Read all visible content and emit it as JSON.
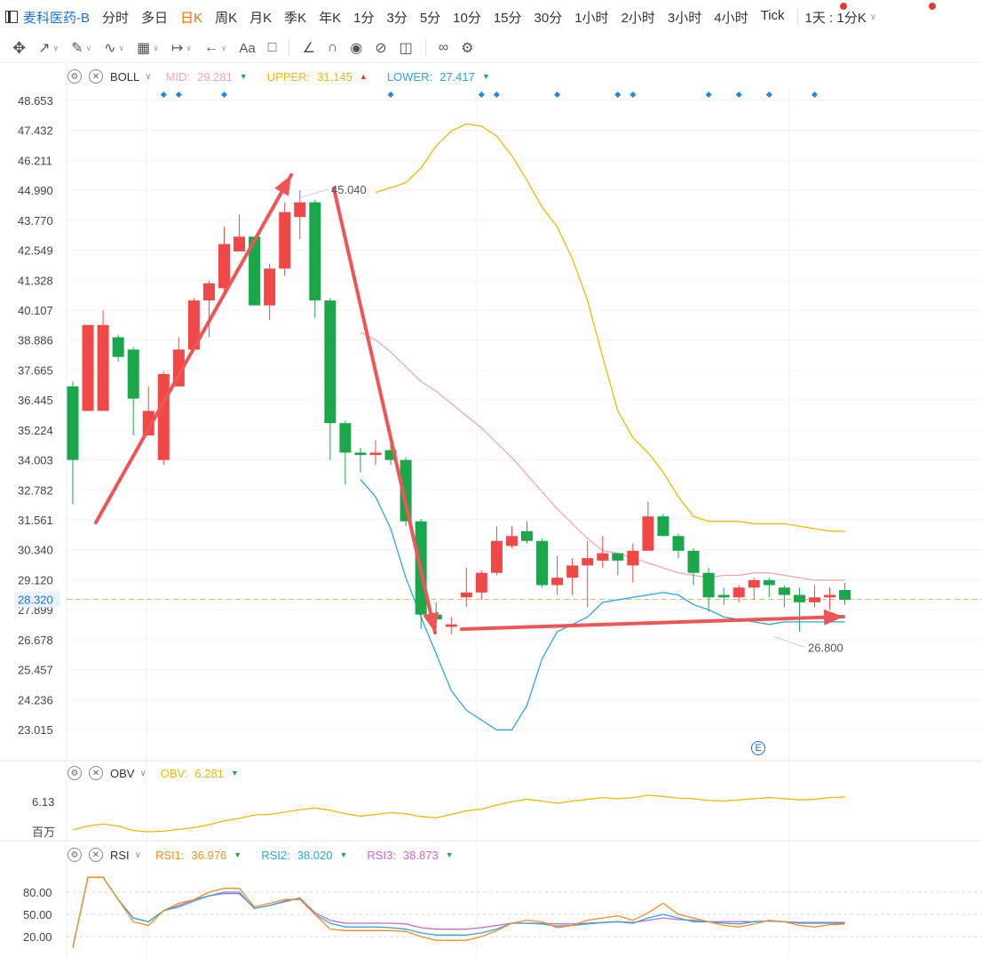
{
  "topbar": {
    "symbol": "麦科医药-B",
    "periods": [
      "分时",
      "多日",
      "日K",
      "周K",
      "月K",
      "季K",
      "年K",
      "1分",
      "3分",
      "5分",
      "10分",
      "15分",
      "30分",
      "1小时",
      "2小时",
      "3小时",
      "4小时",
      "Tick"
    ],
    "active_period": "日K",
    "interval_label": "1天 : 1分K"
  },
  "boll": {
    "name": "BOLL",
    "mid_label": "MID:",
    "mid_value": "29.281",
    "upper_label": "UPPER:",
    "upper_value": "31.145",
    "lower_label": "LOWER:",
    "lower_value": "27.417",
    "colors": {
      "mid": "#f7a6b5",
      "upper": "#f5b800",
      "lower": "#29a7e1"
    }
  },
  "price_axis": [
    "48.653",
    "47.432",
    "46.211",
    "44.990",
    "43.770",
    "42.549",
    "41.328",
    "40.107",
    "38.886",
    "37.665",
    "36.445",
    "35.224",
    "34.003",
    "32.782",
    "31.561",
    "30.340",
    "29.120",
    "27.899",
    "26.678",
    "25.457",
    "24.236",
    "23.015"
  ],
  "current_price": "28.320",
  "annotations": {
    "high": "45.040",
    "low": "26.800"
  },
  "obv": {
    "name": "OBV",
    "label": "OBV:",
    "value": "6.281",
    "axis_value": "6.13",
    "unit": "百万"
  },
  "rsi": {
    "name": "RSI",
    "rsi1_label": "RSI1:",
    "rsi1_value": "36.976",
    "rsi2_label": "RSI2:",
    "rsi2_value": "38.020",
    "rsi3_label": "RSI3:",
    "rsi3_value": "38.873",
    "axis": [
      "80.00",
      "50.00",
      "20.00"
    ],
    "colors": {
      "rsi1": "#ff8c1a",
      "rsi2": "#29a7e1",
      "rsi3": "#cc66cc"
    }
  },
  "chart_data": {
    "type": "candlestick",
    "candles": [
      [
        37.0,
        34.0,
        37.2,
        32.2
      ],
      [
        36.0,
        39.5,
        39.5,
        36.0
      ],
      [
        36.0,
        39.5,
        40.1,
        36.0
      ],
      [
        39.0,
        38.2,
        39.1,
        38.0
      ],
      [
        38.5,
        36.5,
        38.6,
        35.0
      ],
      [
        35.0,
        36.0,
        37.0,
        35.0
      ],
      [
        34.0,
        37.5,
        37.6,
        33.8
      ],
      [
        37.0,
        38.5,
        39.0,
        37.0
      ],
      [
        38.5,
        40.5,
        40.6,
        38.5
      ],
      [
        40.5,
        41.2,
        41.3,
        39.0
      ],
      [
        41.0,
        42.8,
        43.5,
        40.8
      ],
      [
        42.5,
        43.1,
        44.0,
        42.5
      ],
      [
        43.1,
        40.3,
        43.1,
        40.3
      ],
      [
        40.3,
        41.8,
        42.0,
        39.7
      ],
      [
        41.8,
        44.1,
        44.5,
        41.5
      ],
      [
        43.9,
        44.5,
        45.0,
        43.0
      ],
      [
        44.5,
        40.5,
        44.6,
        39.8
      ],
      [
        40.5,
        35.5,
        40.6,
        34.0
      ],
      [
        35.5,
        34.3,
        35.6,
        33.0
      ],
      [
        34.3,
        34.2,
        34.5,
        33.5
      ],
      [
        34.2,
        34.3,
        34.8,
        33.8
      ],
      [
        34.4,
        34.0,
        34.7,
        33.8
      ],
      [
        34.0,
        31.5,
        34.1,
        31.3
      ],
      [
        31.5,
        27.7,
        31.6,
        27.1
      ],
      [
        27.7,
        27.5,
        28.2,
        27.1
      ],
      [
        27.2,
        27.3,
        27.6,
        26.9
      ],
      [
        28.4,
        28.6,
        29.6,
        28.0
      ],
      [
        28.6,
        29.4,
        29.5,
        28.3
      ],
      [
        29.4,
        30.7,
        31.3,
        29.3
      ],
      [
        30.5,
        30.9,
        31.3,
        30.4
      ],
      [
        31.1,
        30.7,
        31.5,
        30.6
      ],
      [
        30.7,
        28.9,
        30.8,
        28.8
      ],
      [
        28.9,
        29.2,
        30.1,
        28.5
      ],
      [
        29.2,
        29.7,
        30.0,
        28.5
      ],
      [
        29.7,
        30.0,
        30.7,
        28.0
      ],
      [
        29.9,
        30.2,
        30.9,
        29.6
      ],
      [
        30.2,
        29.9,
        30.2,
        29.3
      ],
      [
        29.7,
        30.3,
        30.6,
        29.0
      ],
      [
        30.3,
        31.7,
        32.3,
        30.3
      ],
      [
        31.7,
        30.9,
        31.8,
        30.9
      ],
      [
        30.9,
        30.3,
        31.0,
        30.0
      ],
      [
        30.3,
        29.4,
        30.4,
        28.9
      ],
      [
        29.4,
        28.4,
        29.6,
        27.8
      ],
      [
        28.5,
        28.4,
        28.8,
        28.1
      ],
      [
        28.4,
        28.8,
        28.9,
        28.2
      ],
      [
        28.8,
        29.1,
        29.2,
        28.3
      ],
      [
        29.1,
        28.9,
        29.2,
        28.4
      ],
      [
        28.8,
        28.5,
        28.9,
        28.0
      ],
      [
        28.5,
        28.2,
        28.8,
        27.0
      ],
      [
        28.2,
        28.4,
        28.9,
        28.0
      ],
      [
        28.4,
        28.5,
        28.8,
        27.9
      ],
      [
        28.7,
        28.3,
        29.0,
        28.1
      ]
    ],
    "upper": [
      null,
      null,
      null,
      null,
      null,
      null,
      null,
      null,
      null,
      null,
      null,
      null,
      null,
      null,
      null,
      null,
      null,
      null,
      null,
      null,
      44.9,
      45.1,
      45.3,
      45.9,
      46.8,
      47.4,
      47.7,
      47.6,
      47.2,
      46.4,
      45.4,
      44.3,
      43.5,
      42.2,
      40.5,
      38.2,
      36.0,
      34.9,
      34.3,
      33.5,
      32.5,
      31.7,
      31.5,
      31.5,
      31.5,
      31.4,
      31.4,
      31.4,
      31.3,
      31.2,
      31.1,
      31.1
    ],
    "mid": [
      null,
      null,
      null,
      null,
      null,
      null,
      null,
      null,
      null,
      null,
      null,
      null,
      null,
      null,
      null,
      null,
      null,
      null,
      null,
      39.2,
      38.9,
      38.4,
      37.8,
      37.2,
      36.8,
      36.3,
      35.8,
      35.3,
      34.7,
      34.1,
      33.4,
      32.7,
      32.0,
      31.4,
      30.8,
      30.3,
      30.2,
      30.0,
      29.8,
      29.6,
      29.4,
      29.3,
      29.2,
      29.3,
      29.3,
      29.4,
      29.4,
      29.3,
      29.2,
      29.1,
      29.1,
      29.1
    ],
    "lower": [
      null,
      null,
      null,
      null,
      null,
      null,
      null,
      null,
      null,
      null,
      null,
      null,
      null,
      null,
      null,
      null,
      null,
      null,
      null,
      33.2,
      32.5,
      31.2,
      29.2,
      27.6,
      26.1,
      24.6,
      23.8,
      23.4,
      23.0,
      23.0,
      24.0,
      25.9,
      27.0,
      27.3,
      27.6,
      28.2,
      28.3,
      28.4,
      28.5,
      28.6,
      28.5,
      28.1,
      27.9,
      27.6,
      27.5,
      27.4,
      27.3,
      27.4,
      27.4,
      27.4,
      27.4,
      27.4
    ],
    "obv": [
      0.3,
      1.0,
      1.3,
      1.0,
      0.2,
      0.0,
      0.1,
      0.4,
      0.7,
      1.2,
      1.9,
      2.3,
      2.9,
      3.0,
      3.4,
      3.8,
      4.1,
      3.7,
      3.1,
      2.7,
      3.0,
      3.3,
      3.1,
      2.6,
      2.4,
      3.0,
      3.6,
      3.9,
      4.6,
      5.2,
      5.6,
      5.3,
      4.9,
      5.3,
      5.6,
      5.9,
      5.7,
      5.9,
      6.3,
      6.1,
      5.8,
      5.7,
      5.4,
      5.3,
      5.5,
      5.7,
      5.9,
      5.7,
      5.5,
      5.6,
      5.9,
      6.0
    ],
    "rsi1": [
      5,
      100,
      100,
      70,
      40,
      35,
      55,
      65,
      70,
      80,
      85,
      85,
      60,
      65,
      70,
      70,
      50,
      30,
      28,
      28,
      28,
      28,
      27,
      20,
      15,
      15,
      15,
      20,
      28,
      38,
      42,
      40,
      32,
      35,
      42,
      45,
      48,
      42,
      52,
      65,
      50,
      45,
      40,
      35,
      33,
      37,
      42,
      40,
      35,
      33,
      36,
      37
    ],
    "rsi2": [
      5,
      100,
      100,
      70,
      45,
      40,
      55,
      60,
      68,
      75,
      80,
      80,
      58,
      62,
      68,
      72,
      50,
      38,
      33,
      33,
      33,
      32,
      30,
      25,
      22,
      22,
      22,
      25,
      30,
      38,
      38,
      37,
      34,
      35,
      37,
      39,
      40,
      38,
      45,
      50,
      45,
      40,
      40,
      38,
      37,
      40,
      41,
      40,
      38,
      38,
      38,
      38
    ],
    "rsi3": [
      5,
      100,
      100,
      70,
      45,
      40,
      55,
      62,
      70,
      75,
      78,
      78,
      58,
      62,
      67,
      72,
      52,
      42,
      38,
      38,
      38,
      38,
      37,
      32,
      30,
      30,
      30,
      32,
      35,
      38,
      38,
      38,
      37,
      37,
      38,
      39,
      40,
      39,
      42,
      45,
      43,
      42,
      40,
      40,
      40,
      40,
      41,
      40,
      39,
      39,
      39,
      39
    ]
  }
}
